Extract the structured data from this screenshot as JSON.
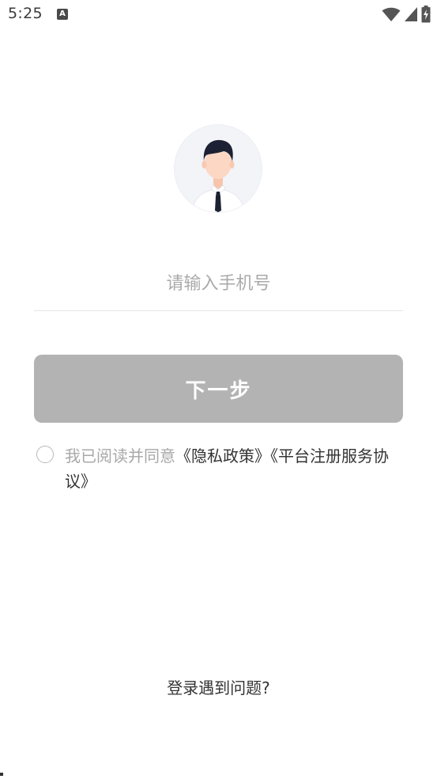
{
  "status_bar": {
    "time": "5:25",
    "notification_icon": "A",
    "icons": [
      "wifi-icon",
      "signal-icon",
      "battery-charging-icon"
    ]
  },
  "avatar": {
    "icon": "user-avatar-icon"
  },
  "phone": {
    "value": "",
    "placeholder": "请输入手机号"
  },
  "next_button": {
    "label": "下一步"
  },
  "agreement": {
    "checked": false,
    "prefix": "我已阅读并同意",
    "privacy_link": "《隐私政策》",
    "terms_link": "《平台注册服务协议》"
  },
  "help": {
    "label": "登录遇到问题?"
  },
  "colors": {
    "button_disabled": "#b3b3b3",
    "placeholder": "#aaaaaa",
    "text_dark": "#333333",
    "text_muted": "#a8a8a8"
  }
}
